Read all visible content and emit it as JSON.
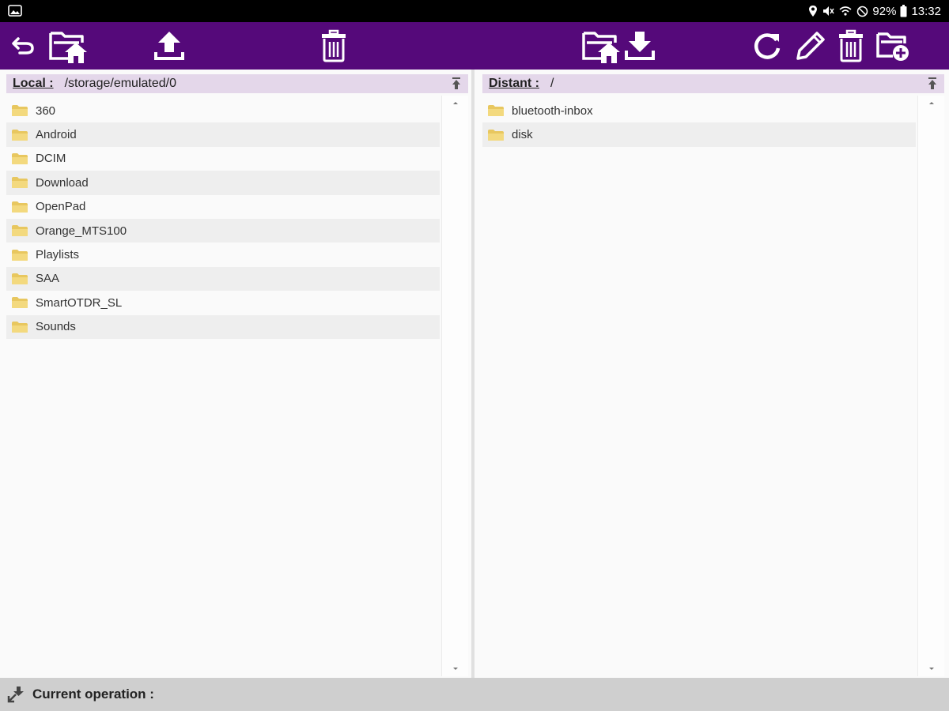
{
  "status_bar": {
    "battery": "92%",
    "time": "13:32",
    "icons": [
      "gallery-icon",
      "location-icon",
      "mute-icon",
      "wifi-calling-icon",
      "alarm-icon",
      "battery-icon"
    ]
  },
  "toolbar": {
    "left_icons": [
      "back-icon",
      "local-home-icon",
      "upload-icon",
      "local-delete-icon"
    ],
    "right_icons": [
      "remote-home-icon",
      "download-icon",
      "refresh-icon",
      "rename-icon",
      "remote-delete-icon",
      "new-folder-icon"
    ],
    "background": "#55097a"
  },
  "local": {
    "label": "Local :",
    "path": "/storage/emulated/0",
    "items": [
      "360",
      "Android",
      "DCIM",
      "Download",
      "OpenPad",
      "Orange_MTS100",
      "Playlists",
      "SAA",
      "SmartOTDR_SL",
      "Sounds"
    ]
  },
  "distant": {
    "label": "Distant :",
    "path": "/",
    "items": [
      "bluetooth-inbox",
      "disk"
    ]
  },
  "footer": {
    "operation_label": "Current operation :"
  }
}
